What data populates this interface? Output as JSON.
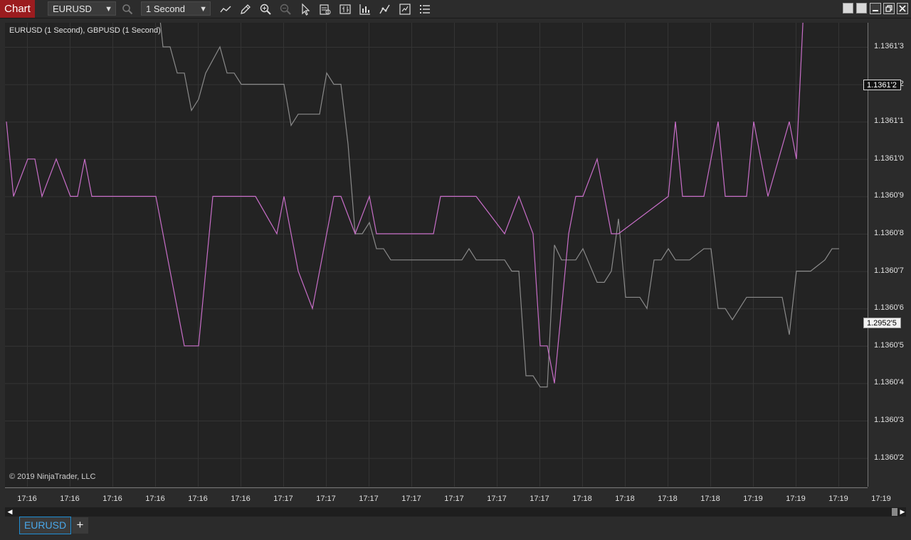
{
  "toolbar": {
    "chart_label": "Chart",
    "instrument": "EURUSD",
    "interval": "1 Second"
  },
  "icons": [
    "search-icon",
    "line-icon",
    "pencil-icon",
    "zoom-in-icon",
    "zoom-out-icon",
    "pointer-icon",
    "data-box-icon",
    "bar-type-icon",
    "indicators-icon",
    "strategies-icon",
    "properties-icon",
    "list-icon"
  ],
  "chart": {
    "legend": "EURUSD (1 Second), GBPUSD (1 Second)",
    "copyright": "© 2019 NinjaTrader, LLC",
    "last_price_eurusd": "1.1361'2",
    "last_price_gbpusd": "1.2952'5",
    "colors": {
      "background": "#232323",
      "eurusd": "#c86ec8",
      "gbpusd": "#8a8a8a",
      "grid": "#343434"
    }
  },
  "chart_data": {
    "type": "line",
    "y_ticks": [
      "1.1361'3",
      "1.1361'2",
      "1.1361'1",
      "1.1361'0",
      "1.1360'9",
      "1.1360'8",
      "1.1360'7",
      "1.1360'6",
      "1.1360'5",
      "1.1360'4",
      "1.1360'3",
      "1.1360'2"
    ],
    "x_ticks": [
      "17:16",
      "17:16",
      "17:16",
      "17:16",
      "17:16",
      "17:16",
      "17:17",
      "17:17",
      "17:17",
      "17:17",
      "17:17",
      "17:17",
      "17:17",
      "17:18",
      "17:18",
      "17:18",
      "17:18",
      "17:19",
      "17:19",
      "17:19",
      "17:19",
      "17:19"
    ],
    "series": [
      {
        "color": "#c86ec8",
        "points": [
          [
            0,
            9
          ],
          [
            1,
            7
          ],
          [
            3,
            8
          ],
          [
            4,
            8
          ],
          [
            5,
            7
          ],
          [
            7,
            8
          ],
          [
            9,
            7
          ],
          [
            10,
            7
          ],
          [
            11,
            8
          ],
          [
            12,
            7
          ],
          [
            21,
            7
          ],
          [
            25,
            3
          ],
          [
            27,
            3
          ],
          [
            29,
            7
          ],
          [
            35,
            7
          ],
          [
            38,
            6
          ],
          [
            39,
            7
          ],
          [
            41,
            5
          ],
          [
            43,
            4
          ],
          [
            46,
            7
          ],
          [
            47,
            7
          ],
          [
            49,
            6
          ],
          [
            51,
            7
          ],
          [
            52,
            6
          ],
          [
            60,
            6
          ],
          [
            61,
            7
          ],
          [
            66,
            7
          ],
          [
            70,
            6
          ],
          [
            72,
            7
          ],
          [
            74,
            6
          ],
          [
            75,
            3
          ],
          [
            76,
            3
          ],
          [
            77,
            2
          ],
          [
            79,
            6
          ],
          [
            80,
            7
          ],
          [
            81,
            7
          ],
          [
            83,
            8
          ],
          [
            85,
            6
          ],
          [
            86,
            6
          ],
          [
            93,
            7
          ],
          [
            94,
            9
          ],
          [
            95,
            7
          ],
          [
            98,
            7
          ],
          [
            100,
            9
          ],
          [
            101,
            7
          ],
          [
            104,
            7
          ],
          [
            105,
            9
          ],
          [
            107,
            7
          ],
          [
            110,
            9
          ],
          [
            111,
            8
          ],
          [
            112,
            12
          ],
          [
            113,
            13
          ],
          [
            114,
            12
          ],
          [
            115,
            12
          ],
          [
            116,
            13
          ],
          [
            120,
            12
          ],
          [
            121,
            13
          ],
          [
            122,
            12
          ]
        ]
      },
      {
        "color": "#8a8a8a",
        "points": [
          [
            0,
            12.6
          ],
          [
            1,
            12.8
          ],
          [
            2,
            12.8
          ],
          [
            3,
            12.6
          ],
          [
            6,
            12.6
          ],
          [
            7,
            12.4
          ],
          [
            8,
            12.4
          ],
          [
            9,
            12.2
          ],
          [
            10,
            12.4
          ],
          [
            12,
            12.4
          ],
          [
            13,
            12.8
          ],
          [
            14,
            12.8
          ],
          [
            15,
            12.6
          ],
          [
            16,
            12.2
          ],
          [
            17,
            12.4
          ],
          [
            18,
            13.0
          ],
          [
            19,
            13.0
          ],
          [
            20,
            12.8
          ],
          [
            21,
            12.8
          ],
          [
            22,
            11.0
          ],
          [
            23,
            11.0
          ],
          [
            24,
            10.3
          ],
          [
            25,
            10.3
          ],
          [
            26,
            9.3
          ],
          [
            27,
            9.6
          ],
          [
            28,
            10.3
          ],
          [
            30,
            11.0
          ],
          [
            31,
            10.3
          ],
          [
            32,
            10.3
          ],
          [
            33,
            10.0
          ],
          [
            39,
            10.0
          ],
          [
            40,
            8.9
          ],
          [
            41,
            9.2
          ],
          [
            44,
            9.2
          ],
          [
            45,
            10.3
          ],
          [
            46,
            10.0
          ],
          [
            47,
            10.0
          ],
          [
            48,
            8.4
          ],
          [
            49,
            6.0
          ],
          [
            50,
            6.0
          ],
          [
            51,
            6.3
          ],
          [
            52,
            5.6
          ],
          [
            53,
            5.6
          ],
          [
            54,
            5.3
          ],
          [
            64,
            5.3
          ],
          [
            65,
            5.6
          ],
          [
            66,
            5.3
          ],
          [
            70,
            5.3
          ],
          [
            71,
            5.0
          ],
          [
            72,
            5.0
          ],
          [
            73,
            2.2
          ],
          [
            74,
            2.2
          ],
          [
            75,
            1.9
          ],
          [
            76,
            1.9
          ],
          [
            77,
            5.7
          ],
          [
            78,
            5.3
          ],
          [
            80,
            5.3
          ],
          [
            81,
            5.6
          ],
          [
            83,
            4.7
          ],
          [
            84,
            4.7
          ],
          [
            85,
            5.0
          ],
          [
            86,
            6.4
          ],
          [
            87,
            4.3
          ],
          [
            89,
            4.3
          ],
          [
            90,
            4.0
          ],
          [
            91,
            5.3
          ],
          [
            92,
            5.3
          ],
          [
            93,
            5.6
          ],
          [
            94,
            5.3
          ],
          [
            96,
            5.3
          ],
          [
            98,
            5.6
          ],
          [
            99,
            5.6
          ],
          [
            100,
            4.0
          ],
          [
            101,
            4.0
          ],
          [
            102,
            3.7
          ],
          [
            103,
            4.0
          ],
          [
            104,
            4.3
          ],
          [
            109,
            4.3
          ],
          [
            110,
            3.3
          ],
          [
            111,
            5.0
          ],
          [
            113,
            5.0
          ],
          [
            115,
            5.3
          ],
          [
            116,
            5.6
          ],
          [
            117,
            5.6
          ]
        ]
      }
    ],
    "grid": true
  },
  "tabs": {
    "active": "EURUSD",
    "add": "+"
  }
}
